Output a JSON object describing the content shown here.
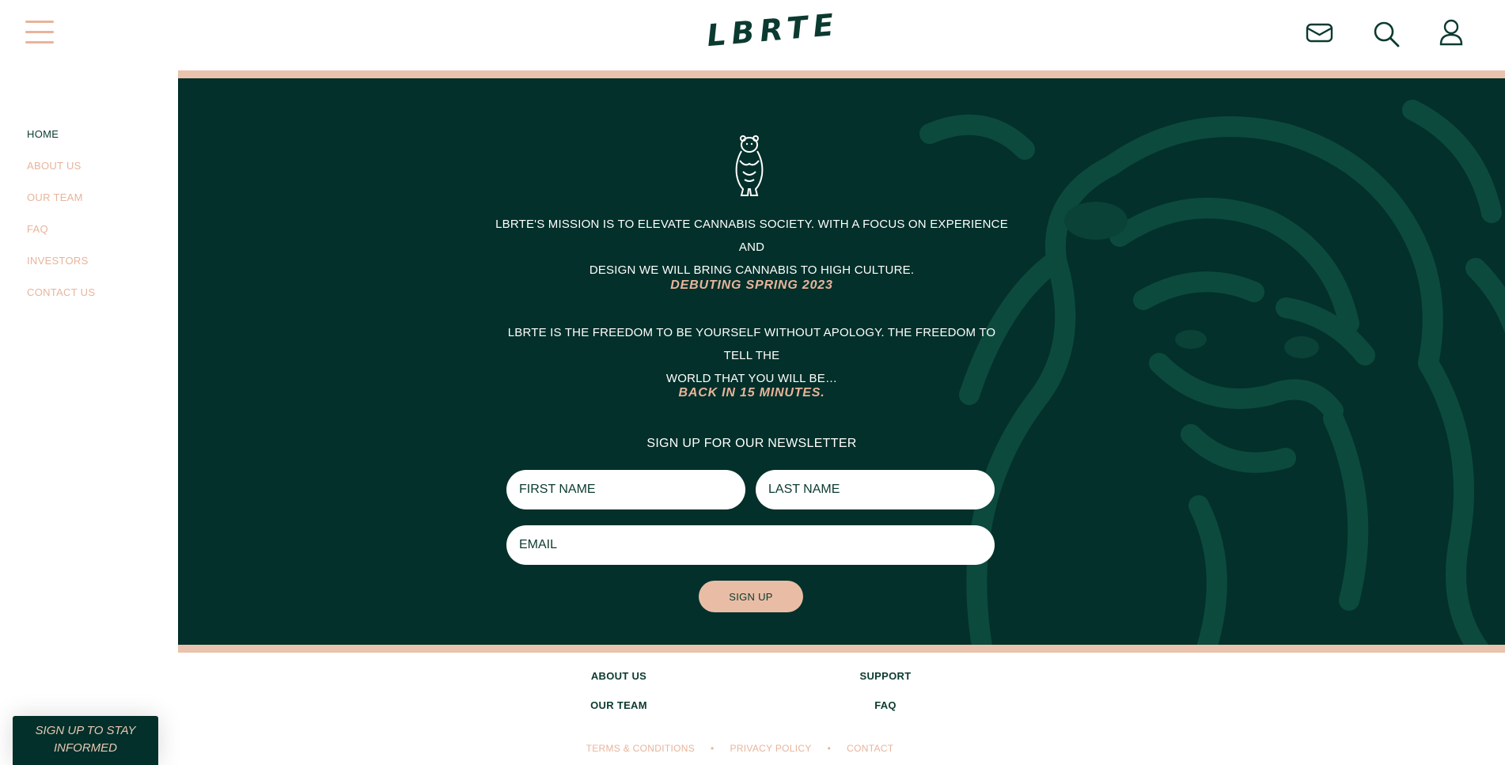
{
  "header": {
    "logo": "LBRTE",
    "icons": [
      "menu-icon",
      "mail-icon",
      "search-icon",
      "user-icon"
    ]
  },
  "sidebar": {
    "items": [
      {
        "label": "HOME",
        "active": true
      },
      {
        "label": "ABOUT US",
        "active": false
      },
      {
        "label": "OUR TEAM",
        "active": false
      },
      {
        "label": "FAQ",
        "active": false
      },
      {
        "label": "INVESTORS",
        "active": false
      },
      {
        "label": "CONTACT US",
        "active": false
      }
    ]
  },
  "hero": {
    "mission_line1": "LBRTE'S MISSION IS TO ELEVATE CANNABIS SOCIETY.  WITH A FOCUS ON EXPERIENCE AND",
    "mission_line2": "DESIGN WE WILL BRING CANNABIS TO HIGH CULTURE.",
    "debut": "DEBUTING SPRING 2023",
    "freedom_line1": "LBRTE IS THE FREEDOM TO BE YOURSELF WITHOUT APOLOGY. THE FREEDOM TO TELL THE",
    "freedom_line2": "WORLD THAT YOU WILL BE…",
    "back": "BACK IN 15 MINUTES."
  },
  "newsletter": {
    "title": "SIGN UP FOR OUR NEWSLETTER",
    "first_name_placeholder": "FIRST NAME",
    "last_name_placeholder": "LAST NAME",
    "email_placeholder": "EMAIL",
    "button": "SIGN UP"
  },
  "footer": {
    "about": "ABOUT US",
    "support": "SUPPORT",
    "team": "OUR TEAM",
    "faq": "FAQ",
    "terms": "TERMS & CONDITIONS",
    "privacy": "PRIVACY POLICY",
    "contact": "CONTACT",
    "separator": "•"
  },
  "popup": {
    "line1": "SIGN UP TO STAY",
    "line2": "INFORMED"
  },
  "colors": {
    "dark_green": "#03302a",
    "peach": "#e8b49b",
    "white": "#ffffff"
  }
}
